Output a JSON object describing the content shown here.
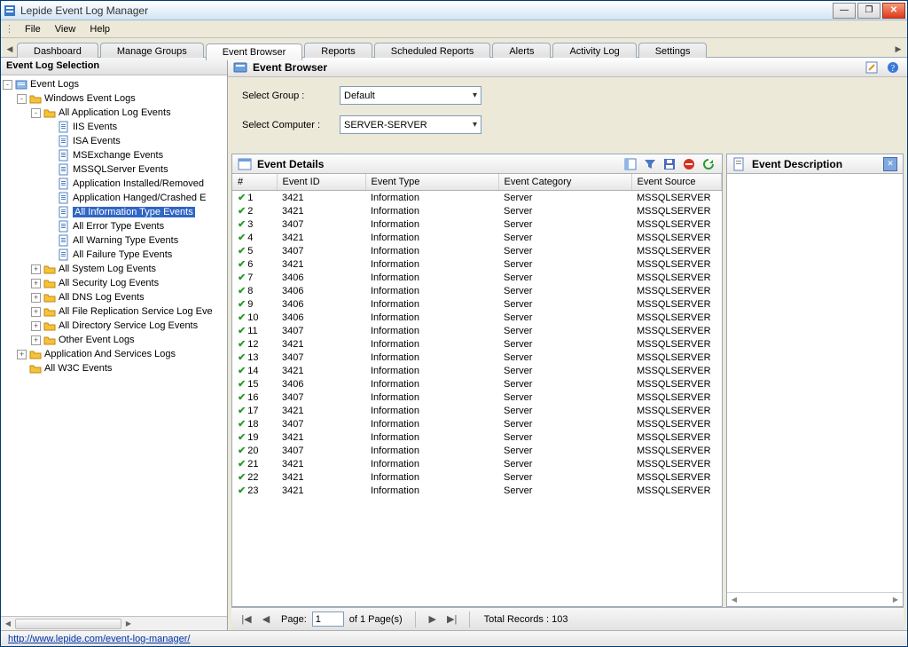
{
  "window_title": "Lepide Event Log Manager",
  "menu": [
    "File",
    "View",
    "Help"
  ],
  "tabs": [
    "Dashboard",
    "Manage Groups",
    "Event Browser",
    "Reports",
    "Scheduled Reports",
    "Alerts",
    "Activity Log",
    "Settings"
  ],
  "active_tab": 2,
  "left_panel_title": "Event Log Selection",
  "tree": {
    "root": "Event Logs",
    "windows": "Windows Event Logs",
    "app_all": "All Application Log Events",
    "app_children": [
      "IIS Events",
      "ISA Events",
      "MSExchange Events",
      "MSSQLServer Events",
      "Application Installed/Removed",
      "Application Hanged/Crashed E",
      "All Information Type Events",
      "All Error Type Events",
      "All Warning Type Events",
      "All Failure Type Events"
    ],
    "selected_index": 6,
    "more_groups": [
      "All System Log Events",
      "All Security Log Events",
      "All DNS Log Events",
      "All File Replication Service Log Eve",
      "All Directory Service Log Events",
      "Other Event Logs"
    ],
    "services": "Application And Services Logs",
    "w3c": "All W3C Events"
  },
  "browser_title": "Event Browser",
  "filters": {
    "group_label": "Select Group :",
    "group_value": "Default",
    "computer_label": "Select Computer :",
    "computer_value": "SERVER-SERVER"
  },
  "details_title": "Event Details",
  "columns": [
    "#",
    "Event ID",
    "Event Type",
    "Event Category",
    "Event Source"
  ],
  "rows": [
    {
      "n": 1,
      "id": 3421,
      "type": "Information",
      "cat": "Server",
      "src": "MSSQLSERVER"
    },
    {
      "n": 2,
      "id": 3421,
      "type": "Information",
      "cat": "Server",
      "src": "MSSQLSERVER"
    },
    {
      "n": 3,
      "id": 3407,
      "type": "Information",
      "cat": "Server",
      "src": "MSSQLSERVER"
    },
    {
      "n": 4,
      "id": 3421,
      "type": "Information",
      "cat": "Server",
      "src": "MSSQLSERVER"
    },
    {
      "n": 5,
      "id": 3407,
      "type": "Information",
      "cat": "Server",
      "src": "MSSQLSERVER"
    },
    {
      "n": 6,
      "id": 3421,
      "type": "Information",
      "cat": "Server",
      "src": "MSSQLSERVER"
    },
    {
      "n": 7,
      "id": 3406,
      "type": "Information",
      "cat": "Server",
      "src": "MSSQLSERVER"
    },
    {
      "n": 8,
      "id": 3406,
      "type": "Information",
      "cat": "Server",
      "src": "MSSQLSERVER"
    },
    {
      "n": 9,
      "id": 3406,
      "type": "Information",
      "cat": "Server",
      "src": "MSSQLSERVER"
    },
    {
      "n": 10,
      "id": 3406,
      "type": "Information",
      "cat": "Server",
      "src": "MSSQLSERVER"
    },
    {
      "n": 11,
      "id": 3407,
      "type": "Information",
      "cat": "Server",
      "src": "MSSQLSERVER"
    },
    {
      "n": 12,
      "id": 3421,
      "type": "Information",
      "cat": "Server",
      "src": "MSSQLSERVER"
    },
    {
      "n": 13,
      "id": 3407,
      "type": "Information",
      "cat": "Server",
      "src": "MSSQLSERVER"
    },
    {
      "n": 14,
      "id": 3421,
      "type": "Information",
      "cat": "Server",
      "src": "MSSQLSERVER"
    },
    {
      "n": 15,
      "id": 3406,
      "type": "Information",
      "cat": "Server",
      "src": "MSSQLSERVER"
    },
    {
      "n": 16,
      "id": 3407,
      "type": "Information",
      "cat": "Server",
      "src": "MSSQLSERVER"
    },
    {
      "n": 17,
      "id": 3421,
      "type": "Information",
      "cat": "Server",
      "src": "MSSQLSERVER"
    },
    {
      "n": 18,
      "id": 3407,
      "type": "Information",
      "cat": "Server",
      "src": "MSSQLSERVER"
    },
    {
      "n": 19,
      "id": 3421,
      "type": "Information",
      "cat": "Server",
      "src": "MSSQLSERVER"
    },
    {
      "n": 20,
      "id": 3407,
      "type": "Information",
      "cat": "Server",
      "src": "MSSQLSERVER"
    },
    {
      "n": 21,
      "id": 3421,
      "type": "Information",
      "cat": "Server",
      "src": "MSSQLSERVER"
    },
    {
      "n": 22,
      "id": 3421,
      "type": "Information",
      "cat": "Server",
      "src": "MSSQLSERVER"
    },
    {
      "n": 23,
      "id": 3421,
      "type": "Information",
      "cat": "Server",
      "src": "MSSQLSERVER"
    }
  ],
  "desc_title": "Event Description",
  "paging": {
    "page_label": "Page:",
    "page_value": "1",
    "of_label": "of 1 Page(s)",
    "total_label": "Total Records : 103"
  },
  "footer_link": "http://www.lepide.com/event-log-manager/"
}
